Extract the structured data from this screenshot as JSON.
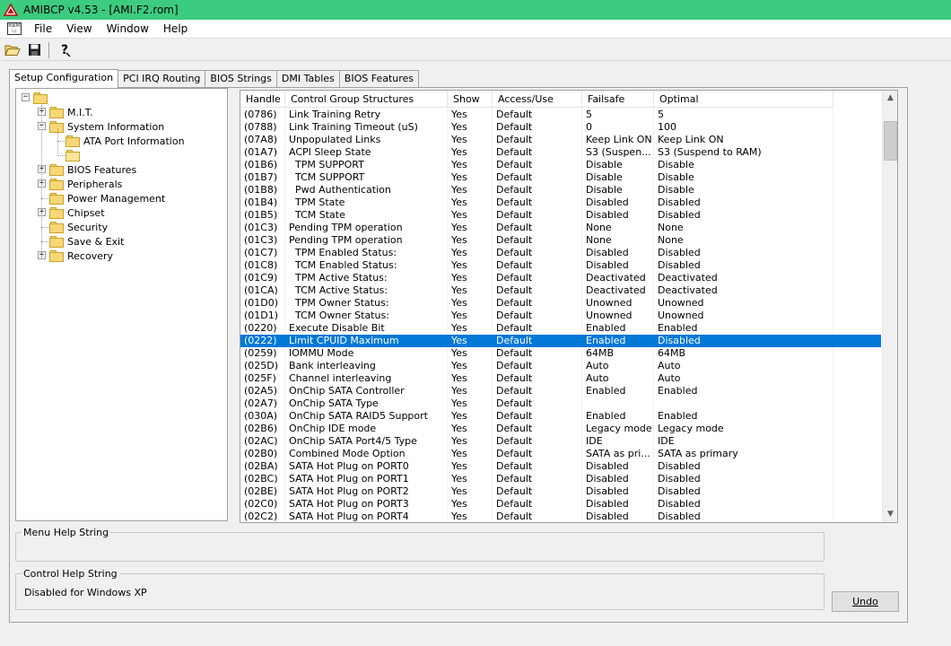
{
  "window": {
    "title": "AMIBCP v4.53 - [AMI.F2.rom]"
  },
  "menubar": {
    "items": [
      "File",
      "View",
      "Window",
      "Help"
    ]
  },
  "toolbar": {
    "buttons": [
      "open-folder-icon",
      "save-icon",
      "help-icon"
    ]
  },
  "tabs": [
    {
      "label": "Setup Configuration",
      "active": true
    },
    {
      "label": "PCI IRQ Routing",
      "active": false
    },
    {
      "label": "BIOS Strings",
      "active": false
    },
    {
      "label": "DMI Tables",
      "active": false
    },
    {
      "label": "BIOS Features",
      "active": false
    }
  ],
  "tree": {
    "nodes": [
      {
        "label": "",
        "expander": "minus",
        "level": 0,
        "icon": "folder"
      },
      {
        "label": "M.I.T.",
        "expander": "plus",
        "level": 1,
        "icon": "folder"
      },
      {
        "label": "System Information",
        "expander": "minus",
        "level": 1,
        "icon": "folder"
      },
      {
        "label": "ATA Port Information",
        "expander": "",
        "level": 2,
        "icon": "folder"
      },
      {
        "label": "",
        "expander": "",
        "level": 2,
        "icon": "folder-open"
      },
      {
        "label": "BIOS Features",
        "expander": "plus",
        "level": 1,
        "icon": "folder"
      },
      {
        "label": "Peripherals",
        "expander": "plus",
        "level": 1,
        "icon": "folder"
      },
      {
        "label": "Power Management",
        "expander": "",
        "level": 1,
        "icon": "folder"
      },
      {
        "label": "Chipset",
        "expander": "plus",
        "level": 1,
        "icon": "folder"
      },
      {
        "label": "Security",
        "expander": "",
        "level": 1,
        "icon": "folder"
      },
      {
        "label": "Save & Exit",
        "expander": "",
        "level": 1,
        "icon": "folder"
      },
      {
        "label": "Recovery",
        "expander": "plus",
        "level": 1,
        "icon": "folder"
      }
    ]
  },
  "grid": {
    "columns": [
      "Handle",
      "Control Group Structures",
      "Show",
      "Access/Use",
      "Failsafe",
      "Optimal"
    ],
    "selected_row": 18,
    "rows": [
      [
        "(0786)",
        "Link Training Retry",
        "Yes",
        "Default",
        "5",
        "5"
      ],
      [
        "(0788)",
        "Link Training Timeout (uS)",
        "Yes",
        "Default",
        "0",
        "100"
      ],
      [
        "(07A8)",
        "Unpopulated Links",
        "Yes",
        "Default",
        "Keep Link ON",
        "Keep Link ON"
      ],
      [
        "(01A7)",
        "ACPI Sleep State",
        "Yes",
        "Default",
        "S3 (Suspen...",
        "S3 (Suspend to RAM)"
      ],
      [
        "(01B6)",
        "  TPM SUPPORT",
        "Yes",
        "Default",
        "Disable",
        "Disable"
      ],
      [
        "(01B7)",
        "  TCM SUPPORT",
        "Yes",
        "Default",
        "Disable",
        "Disable"
      ],
      [
        "(01B8)",
        "  Pwd Authentication",
        "Yes",
        "Default",
        "Disable",
        "Disable"
      ],
      [
        "(01B4)",
        "  TPM State",
        "Yes",
        "Default",
        "Disabled",
        "Disabled"
      ],
      [
        "(01B5)",
        "  TCM State",
        "Yes",
        "Default",
        "Disabled",
        "Disabled"
      ],
      [
        "(01C3)",
        "Pending TPM operation",
        "Yes",
        "Default",
        "None",
        "None"
      ],
      [
        "(01C3)",
        "Pending TPM operation",
        "Yes",
        "Default",
        "None",
        "None"
      ],
      [
        "(01C7)",
        "  TPM Enabled Status:",
        "Yes",
        "Default",
        "Disabled",
        "Disabled"
      ],
      [
        "(01C8)",
        "  TCM Enabled Status:",
        "Yes",
        "Default",
        "Disabled",
        "Disabled"
      ],
      [
        "(01C9)",
        "  TPM Active Status:",
        "Yes",
        "Default",
        "Deactivated",
        "Deactivated"
      ],
      [
        "(01CA)",
        "  TCM Active Status:",
        "Yes",
        "Default",
        "Deactivated",
        "Deactivated"
      ],
      [
        "(01D0)",
        "  TPM Owner Status:",
        "Yes",
        "Default",
        "Unowned",
        "Unowned"
      ],
      [
        "(01D1)",
        "  TCM Owner Status:",
        "Yes",
        "Default",
        "Unowned",
        "Unowned"
      ],
      [
        "(0220)",
        "Execute Disable Bit",
        "Yes",
        "Default",
        "Enabled",
        "Enabled"
      ],
      [
        "(0222)",
        "Limit CPUID Maximum",
        "Yes",
        "Default",
        "Enabled",
        "Disabled"
      ],
      [
        "(0259)",
        "IOMMU Mode",
        "Yes",
        "Default",
        "64MB",
        "64MB"
      ],
      [
        "(025D)",
        "Bank interleaving",
        "Yes",
        "Default",
        "Auto",
        "Auto"
      ],
      [
        "(025F)",
        "Channel interleaving",
        "Yes",
        "Default",
        "Auto",
        "Auto"
      ],
      [
        "(02A5)",
        "OnChip SATA Controller",
        "Yes",
        "Default",
        "Enabled",
        "Enabled"
      ],
      [
        "(02A7)",
        "OnChip SATA Type",
        "Yes",
        "Default",
        "",
        ""
      ],
      [
        "(030A)",
        "OnChip SATA RAID5 Support",
        "Yes",
        "Default",
        "Enabled",
        "Enabled"
      ],
      [
        "(02B6)",
        "OnChip IDE mode",
        "Yes",
        "Default",
        "Legacy mode",
        "Legacy mode"
      ],
      [
        "(02AC)",
        "OnChip SATA Port4/5 Type",
        "Yes",
        "Default",
        "IDE",
        "IDE"
      ],
      [
        "(02B0)",
        "Combined Mode Option",
        "Yes",
        "Default",
        "SATA as pri...",
        "SATA as primary"
      ],
      [
        "(02BA)",
        "SATA Hot Plug on PORT0",
        "Yes",
        "Default",
        "Disabled",
        "Disabled"
      ],
      [
        "(02BC)",
        "SATA Hot Plug on PORT1",
        "Yes",
        "Default",
        "Disabled",
        "Disabled"
      ],
      [
        "(02BE)",
        "SATA Hot Plug on PORT2",
        "Yes",
        "Default",
        "Disabled",
        "Disabled"
      ],
      [
        "(02C0)",
        "SATA Hot Plug on PORT3",
        "Yes",
        "Default",
        "Disabled",
        "Disabled"
      ],
      [
        "(02C2)",
        "SATA Hot Plug on PORT4",
        "Yes",
        "Default",
        "Disabled",
        "Disabled"
      ]
    ]
  },
  "help": {
    "menu_title": "Menu Help String",
    "menu_text": "",
    "control_title": "Control Help String",
    "control_text": "Disabled for Windows XP"
  },
  "buttons": {
    "undo_label": "Undo"
  },
  "colors": {
    "titlebar": "#3ccc7f",
    "selection": "#0078d7",
    "folder": "#f8d775"
  }
}
